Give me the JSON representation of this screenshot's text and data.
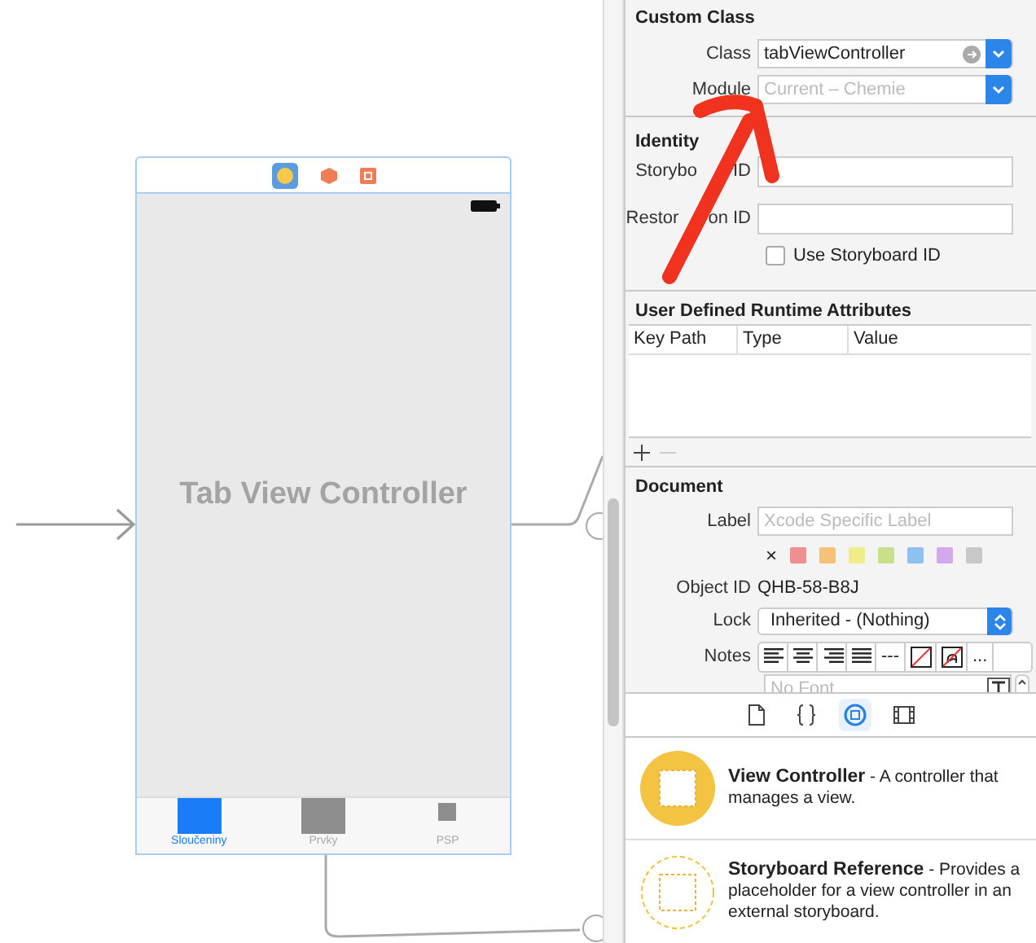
{
  "canvas": {
    "scene": {
      "title": "Tab View Controller",
      "tabs": [
        {
          "label": "Sloučeniny",
          "selected": true
        },
        {
          "label": "Prvky",
          "selected": false
        },
        {
          "label": "PSP",
          "selected": false
        }
      ]
    }
  },
  "inspector": {
    "custom_class": {
      "title": "Custom Class",
      "fields": [
        {
          "label": "Class",
          "value": "tabViewController",
          "kind": "class"
        },
        {
          "label": "Module",
          "placeholder": "Current – Chemie",
          "kind": "module"
        }
      ]
    },
    "identity": {
      "title": "Identity",
      "fields": [
        {
          "label_parts": [
            "Storybo",
            "ID"
          ]
        },
        {
          "label_parts": [
            "Restor",
            "on ID"
          ]
        }
      ],
      "checkbox": {
        "label": "Use Storyboard ID",
        "checked": false
      }
    },
    "runtime_attributes": {
      "title": "User Defined Runtime Attributes",
      "columns": [
        "Key Path",
        "Type",
        "Value"
      ]
    },
    "document": {
      "title": "Document",
      "label_field": {
        "label": "Label",
        "placeholder": "Xcode Specific Label"
      },
      "clear_mark": "×",
      "label_colors": [
        {
          "color": "#f08f8f"
        },
        {
          "color": "#f5c27a"
        },
        {
          "color": "#f0ec8a"
        },
        {
          "color": "#c9e08a"
        },
        {
          "color": "#8fc1f0"
        },
        {
          "color": "#d3a9ee"
        },
        {
          "color": "#c8c8c8"
        }
      ],
      "object_id": {
        "label": "Object ID",
        "value": "QHB-58-B8J"
      },
      "lock": {
        "label": "Lock",
        "value": "Inherited - (Nothing)"
      },
      "notes": {
        "label": "Notes",
        "tools": [
          {
            "kind": "align-left"
          },
          {
            "kind": "align-center"
          },
          {
            "kind": "align-right"
          },
          {
            "kind": "justify"
          },
          {
            "kind": "text",
            "text": "---"
          },
          {
            "kind": "no-color"
          },
          {
            "kind": "no-text-color"
          },
          {
            "kind": "text",
            "text": "..."
          }
        ],
        "font_placeholder": "No Font"
      }
    },
    "library_tabs": [
      {
        "kind": "file",
        "selected": false
      },
      {
        "kind": "braces",
        "selected": false
      },
      {
        "kind": "object",
        "selected": true
      },
      {
        "kind": "media",
        "selected": false
      }
    ],
    "library": [
      {
        "kind": "filled",
        "title": "View Controller",
        "description": " - A controller that manages a view."
      },
      {
        "kind": "dashed",
        "title": "Storyboard Reference",
        "description": " - Provides a placeholder for a view controller in an external storyboard."
      }
    ]
  }
}
